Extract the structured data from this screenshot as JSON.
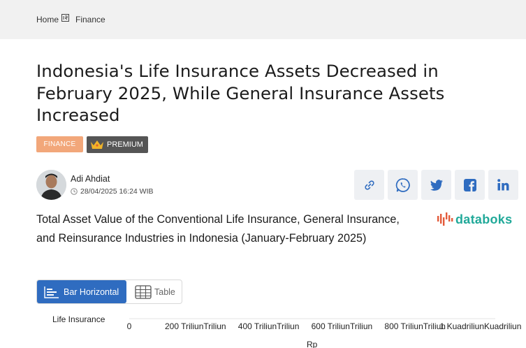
{
  "breadcrumb": {
    "home": "Home",
    "current": "Finance"
  },
  "article": {
    "title": "Indonesia's Life Insurance Assets Decreased in February 2025, While General Insurance Assets Increased",
    "category": "FINANCE",
    "premium": "PREMIUM"
  },
  "author": {
    "name": "Adi Ahdiat",
    "date": "28/04/2025 16:24 WIB"
  },
  "share": [
    "link-icon",
    "whatsapp-icon",
    "twitter-icon",
    "facebook-icon",
    "linkedin-icon"
  ],
  "chart": {
    "title": "Total Asset Value of the Conventional Life Insurance, General Insurance, and Reinsurance Industries in Indonesia (January-February 2025)",
    "brand": "databoks",
    "view_bar": "Bar Horizontal",
    "view_table": "Table"
  },
  "colors": {
    "accent": "#2f6cc0",
    "finance_badge": "#f2a77a",
    "brand": "#21a999",
    "premium_badge": "#555555"
  },
  "chart_data": {
    "type": "bar",
    "orientation": "horizontal",
    "categories": [
      "Life Insurance"
    ],
    "x_ticks": [
      "0",
      "200 TriliunTriliun",
      "400 TriliunTriliun",
      "600 TriliunTriliun",
      "800 TriliunTriliun",
      "1 KuadriliunKuadriliun"
    ],
    "x_tick_values": [
      0,
      200,
      400,
      600,
      800,
      1000
    ],
    "xlabel": "Rp",
    "xlim": [
      0,
      1000
    ],
    "grid": true
  }
}
